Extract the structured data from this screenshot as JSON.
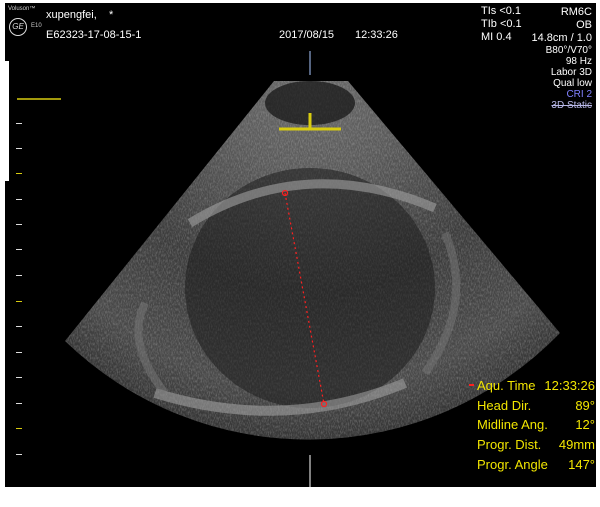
{
  "header": {
    "brand": "Voluson™",
    "model": "E10",
    "patient_name": "xupengfei,",
    "star": "*",
    "patient_id": "E62323-17-08-15-1",
    "date": "2017/08/15",
    "time": "12:33:26",
    "tis": "TIs <0.1",
    "tib": "TIb <0.1",
    "mi": "MI  0.4",
    "probe": "RM6C",
    "preset": "OB",
    "depth": "14.8cm / 1.0"
  },
  "params": {
    "angle": "B80°/V70°",
    "frequency": "98 Hz",
    "mode": "Labor 3D",
    "quality": "Qual low",
    "cri": "CRI 2",
    "static": "3D Static"
  },
  "measurements": [
    {
      "label": "Aqu. Time",
      "value": "12:33:26"
    },
    {
      "label": "Head Dir.",
      "value": "89°"
    },
    {
      "label": "Midline Ang.",
      "value": "12°"
    },
    {
      "label": "Progr. Dist.",
      "value": "49mm"
    },
    {
      "label": "Progr. Angle",
      "value": "147°"
    }
  ],
  "colors": {
    "measure": "#f2e600",
    "cursor_dots": "#ff2020",
    "cri": "#8080ff"
  }
}
